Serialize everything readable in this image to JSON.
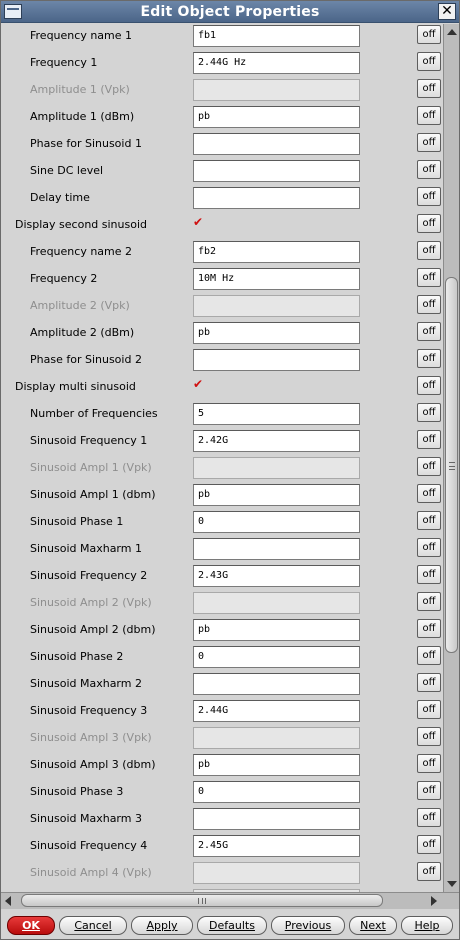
{
  "window": {
    "title": "Edit Object Properties"
  },
  "rows": [
    {
      "label": "Frequency name 1",
      "value": "fb1"
    },
    {
      "label": "Frequency 1",
      "value": "2.44G Hz"
    },
    {
      "label": "Amplitude 1 (Vpk)",
      "value": ""
    },
    {
      "label": "Amplitude 1 (dBm)",
      "value": "pb"
    },
    {
      "label": "Phase for Sinusoid 1",
      "value": ""
    },
    {
      "label": "Sine DC level",
      "value": ""
    },
    {
      "label": "Delay time",
      "value": ""
    },
    {
      "label": "Display second sinusoid",
      "checked": true
    },
    {
      "label": "Frequency name 2",
      "value": "fb2"
    },
    {
      "label": "Frequency 2",
      "value": "10M Hz"
    },
    {
      "label": "Amplitude 2 (Vpk)",
      "value": ""
    },
    {
      "label": "Amplitude 2 (dBm)",
      "value": "pb"
    },
    {
      "label": "Phase for Sinusoid 2",
      "value": ""
    },
    {
      "label": "Display multi sinusoid",
      "checked": true
    },
    {
      "label": "Number of Frequencies",
      "value": "5"
    },
    {
      "label": "Sinusoid Frequency 1",
      "value": "2.42G"
    },
    {
      "label": "Sinusoid Ampl 1 (Vpk)",
      "value": ""
    },
    {
      "label": "Sinusoid Ampl 1 (dbm)",
      "value": "pb"
    },
    {
      "label": "Sinusoid Phase 1",
      "value": "0"
    },
    {
      "label": "Sinusoid Maxharm 1",
      "value": ""
    },
    {
      "label": "Sinusoid Frequency 2",
      "value": "2.43G"
    },
    {
      "label": "Sinusoid Ampl 2 (Vpk)",
      "value": ""
    },
    {
      "label": "Sinusoid Ampl 2 (dbm)",
      "value": "pb"
    },
    {
      "label": "Sinusoid Phase 2",
      "value": "0"
    },
    {
      "label": "Sinusoid Maxharm 2",
      "value": ""
    },
    {
      "label": "Sinusoid Frequency 3",
      "value": "2.44G"
    },
    {
      "label": "Sinusoid Ampl 3 (Vpk)",
      "value": ""
    },
    {
      "label": "Sinusoid Ampl 3 (dbm)",
      "value": "pb"
    },
    {
      "label": "Sinusoid Phase 3",
      "value": "0"
    },
    {
      "label": "Sinusoid Maxharm 3",
      "value": ""
    },
    {
      "label": "Sinusoid Frequency 4",
      "value": "2.45G"
    },
    {
      "label": "Sinusoid Ampl 4 (Vpk)",
      "value": ""
    }
  ],
  "off_label": "off",
  "buttons": {
    "ok": "OK",
    "cancel": "Cancel",
    "apply": "Apply",
    "defaults": "Defaults",
    "previous": "Previous",
    "next": "Next",
    "help": "Help"
  },
  "icons": {
    "close": "close-icon",
    "checkmark": "checkmark-icon"
  },
  "colors": {
    "titlebar": "#5a7496",
    "ok_button": "#d01a1a",
    "checkmark": "#d01010",
    "disabled_text": "#8e8e8e"
  }
}
